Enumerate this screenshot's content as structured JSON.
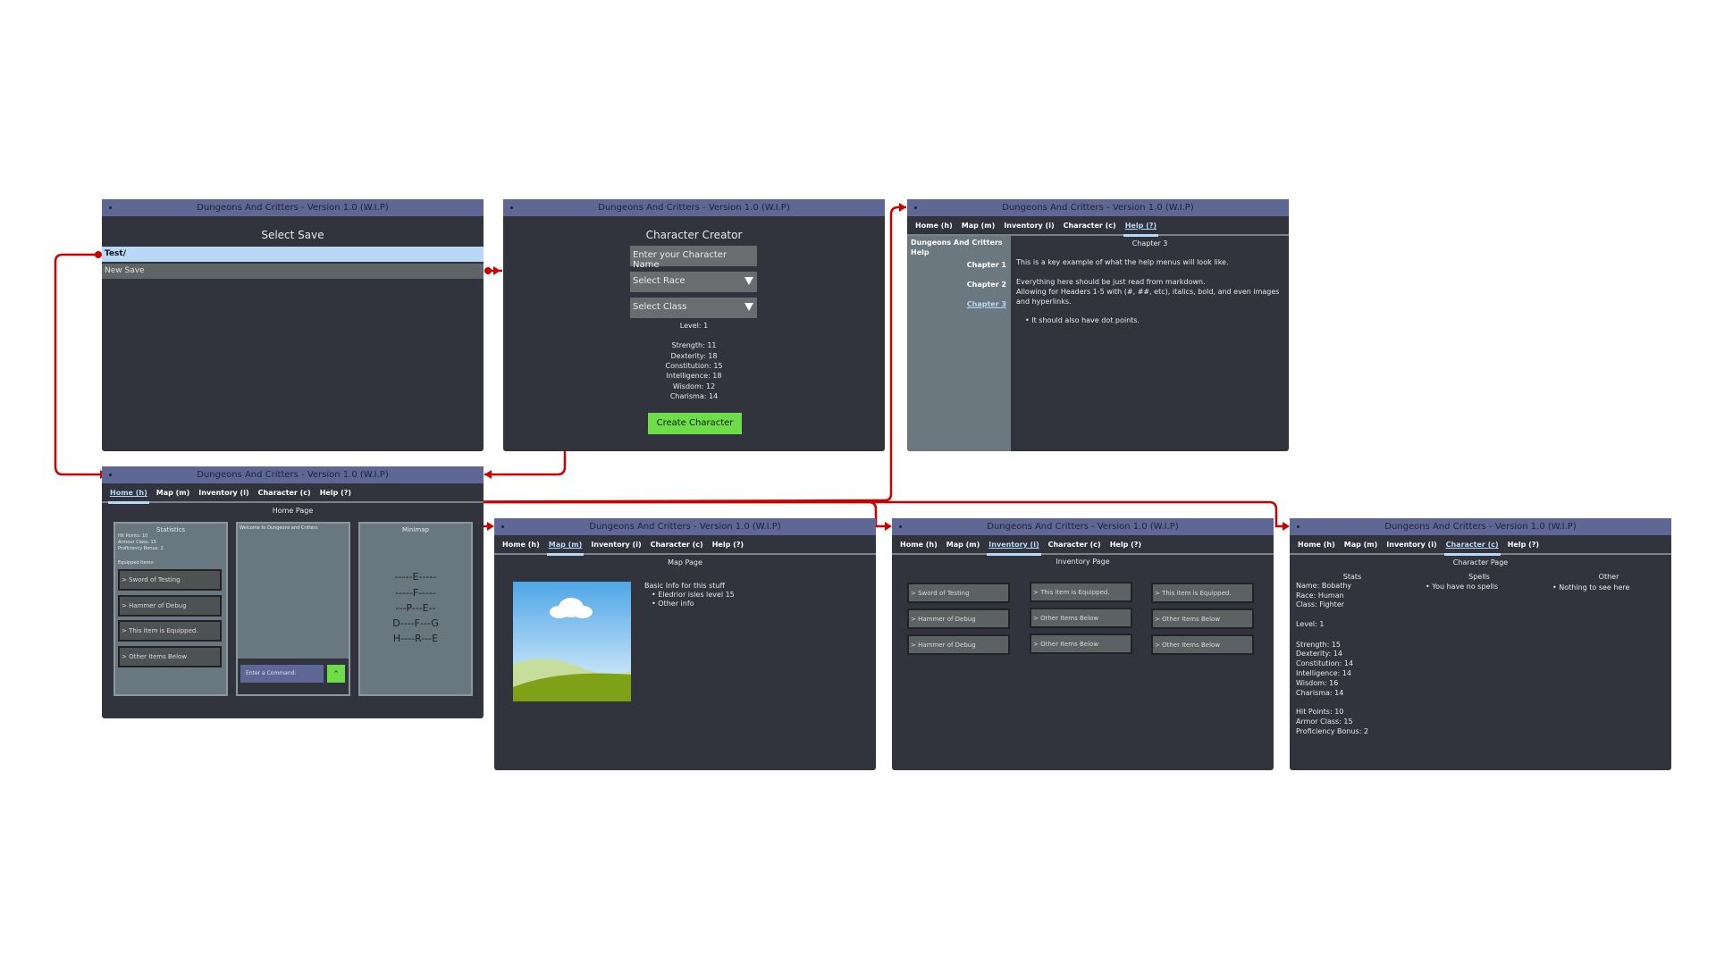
{
  "window_title": "Dungeons And Critters - Version 1.0 (W.I.P)",
  "nav_items": [
    "Home (h)",
    "Map (m)",
    "Inventory (i)",
    "Character (c)",
    "Help (?)"
  ],
  "select_save": {
    "heading": "Select Save",
    "items": [
      "Test/",
      "New Save"
    ]
  },
  "creator": {
    "heading": "Character Creator",
    "name_placeholder": "Enter your Character Name",
    "race_select": "Select Race",
    "class_select": "Select Class",
    "level": "Level: 1",
    "stats": [
      "Strength: 11",
      "Dexterity: 18",
      "Constitution: 15",
      "Intelligence: 18",
      "Wisdom: 12",
      "Charisma: 14"
    ],
    "create_button": "Create Character"
  },
  "help": {
    "sidebar_title_1": "Dungeons And Critters",
    "sidebar_title_2": "Help",
    "chapters": [
      "Chapter 1",
      "Chapter 2",
      "Chapter 3"
    ],
    "heading": "Chapter 3",
    "line1": "This is a key example of what the help menus will look like.",
    "line2": "Everything here should be just read from markdown.",
    "line3": "Allowing for Headers 1-5 with (#, ##, etc), italics, bold,  and even images",
    "line4": "and hyperlinks.",
    "bullet": "It should also have dot points."
  },
  "home": {
    "heading": "Home Page",
    "stats_title": "Statistics",
    "stats_lines": [
      "Hit Points: 10",
      "Armour Class: 15",
      "Proficiency Bonus: 2"
    ],
    "equipped_label": "Equipped Items:",
    "equipped": [
      "> Sword of Testing",
      "> Hammer of Debug",
      "> This item is Equipped.",
      "> Other Items Below"
    ],
    "log_text": "Welcome to Dungeons and Critters",
    "command_placeholder": "Enter a Command:",
    "send_label": "^",
    "minimap_title": "Minimap",
    "minimap_rows": [
      "-----E-----",
      "-----F-----",
      "---P---E--",
      "D----F---G",
      "H----R---E"
    ]
  },
  "map": {
    "heading": "Map Page",
    "info_title": "Basic Info for this stuff",
    "bullets": [
      "Eledrior isles level 15",
      "Other info"
    ]
  },
  "inventory": {
    "heading": "Inventory Page",
    "col1": [
      "> Sword of Testing",
      "> Hammer of Debug",
      "> Hammer of Debug"
    ],
    "col2": [
      "> This item is Equipped.",
      "> Other Items Below",
      "> Other Items Below"
    ],
    "col3": [
      "> This item is Equipped.",
      "> Other Items Below",
      "> Other Items Below"
    ]
  },
  "character": {
    "heading": "Character Page",
    "stats_title": "Stats",
    "spells_title": "Spells",
    "other_title": "Other",
    "info": [
      "Name: Bobathy",
      "Race: Human",
      "Class: Fighter"
    ],
    "level": "Level: 1",
    "stats": [
      "Strength: 15",
      "Dexterity: 14",
      "Constitution: 14",
      "Intelligence: 14",
      "Wisdom: 16",
      "Charisma: 14"
    ],
    "combat": [
      "Hit Points: 10",
      "Armor Class: 15",
      " Proficiency Bonus: 2"
    ],
    "spells_bullet": "You have no spells",
    "other_bullet": "Nothing to see here"
  },
  "colors": {
    "titlebar": "#5f6895",
    "window_bg": "#32343d",
    "connector": "#cc0000",
    "create_button": "#6fdc4a",
    "selected_save": "#b9d8f5",
    "active_tab": "#b9d8f5"
  }
}
